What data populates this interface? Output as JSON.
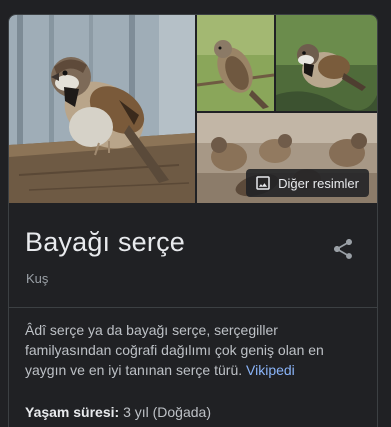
{
  "gallery": {
    "more_images_label": "Diğer resimler",
    "more_images_icon": "image-icon"
  },
  "entity": {
    "title": "Bayağı serçe",
    "subtitle": "Kuş",
    "share_icon": "share-icon"
  },
  "description": {
    "text": "Âdî serçe ya da bayağı serçe, serçegiller familyasından coğrafi dağılımı çok geniş olan en yaygın ve en iyi tanınan serçe türü. ",
    "source_link": "Vikipedi"
  },
  "facts": [
    {
      "label": "Yaşam süresi:",
      "value": "3 yıl (Doğada)"
    }
  ],
  "colors": {
    "background": "#202124",
    "text_primary": "#e8eaed",
    "text_secondary": "#bdc1c6",
    "text_muted": "#9aa0a6",
    "link": "#8ab4f8",
    "divider": "#3c4043"
  }
}
